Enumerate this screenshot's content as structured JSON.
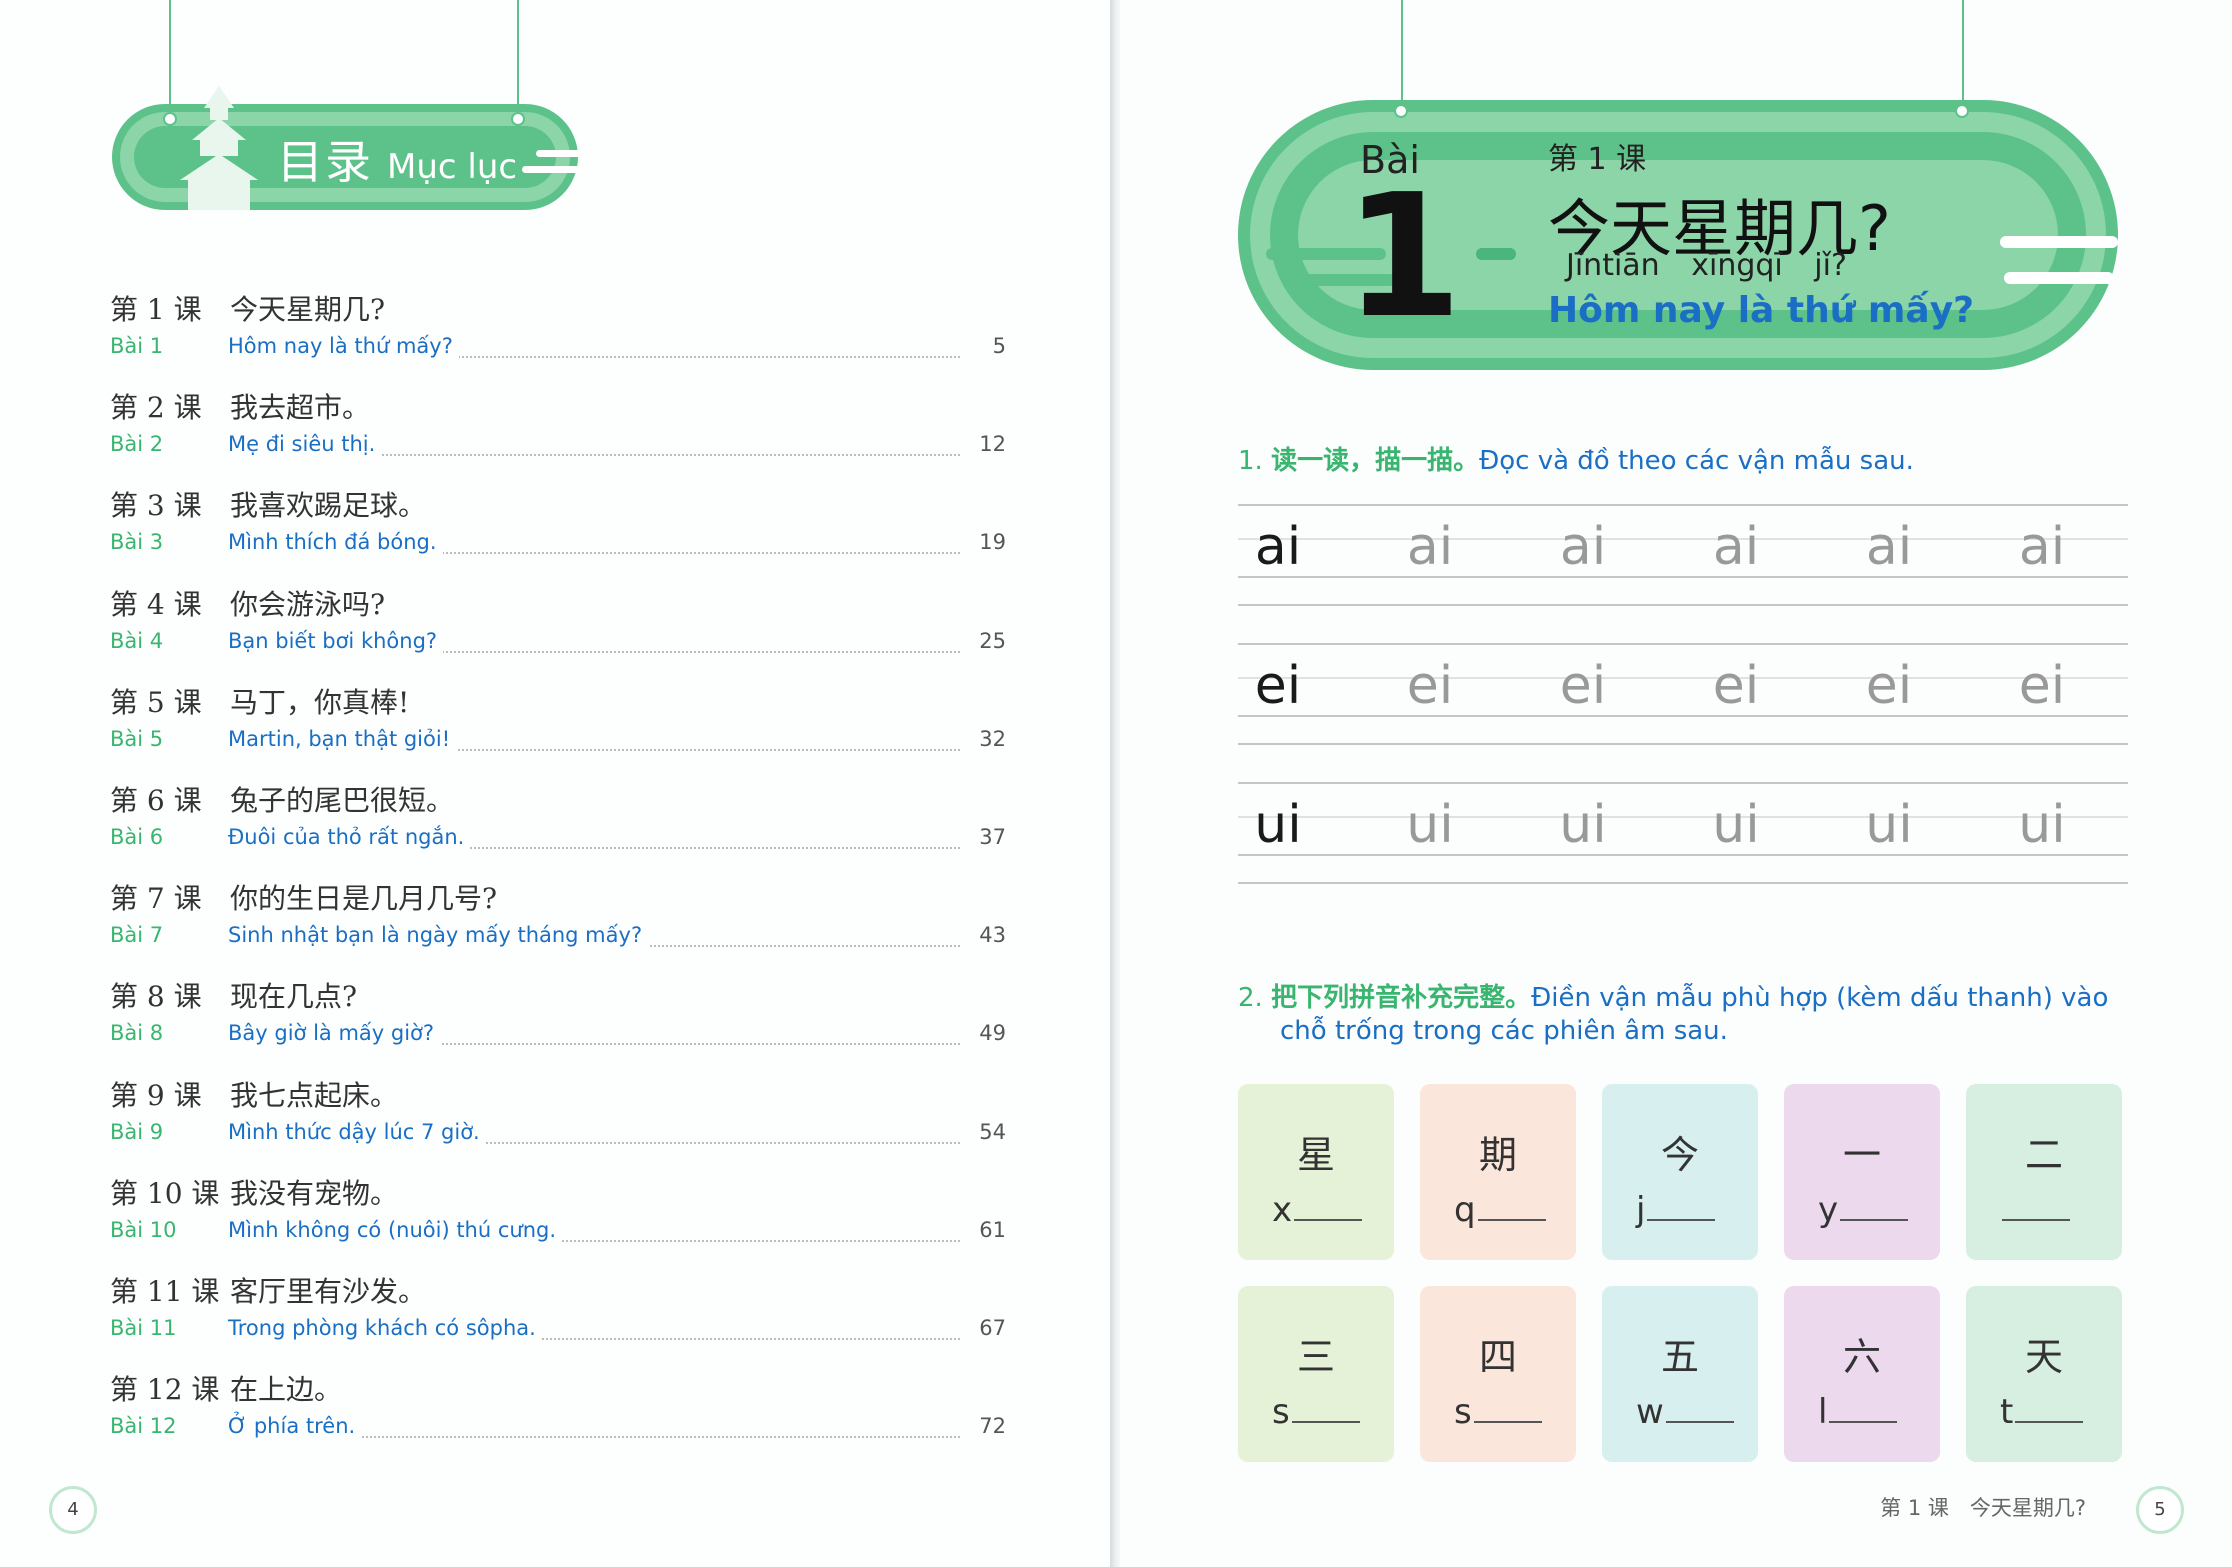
{
  "left_page": {
    "header": {
      "title_cn": "目录",
      "title_vn": "Mục lục"
    },
    "toc": [
      {
        "cn_num": "第 1 课",
        "cn_title": "今天星期几?",
        "vn_num": "Bài 1",
        "vn_title": "Hôm nay là thứ mấy?",
        "page": "5"
      },
      {
        "cn_num": "第 2 课",
        "cn_title": "我去超市。",
        "vn_num": "Bài 2",
        "vn_title": "Mẹ đi siêu thị.",
        "page": "12"
      },
      {
        "cn_num": "第 3 课",
        "cn_title": "我喜欢踢足球。",
        "vn_num": "Bài 3",
        "vn_title": "Mình thích đá bóng.",
        "page": "19"
      },
      {
        "cn_num": "第 4 课",
        "cn_title": "你会游泳吗?",
        "vn_num": "Bài 4",
        "vn_title": "Bạn biết bơi không?",
        "page": "25"
      },
      {
        "cn_num": "第 5 课",
        "cn_title": "马丁，你真棒!",
        "vn_num": "Bài 5",
        "vn_title": "Martin, bạn thật giỏi!",
        "page": "32"
      },
      {
        "cn_num": "第 6 课",
        "cn_title": "兔子的尾巴很短。",
        "vn_num": "Bài 6",
        "vn_title": "Đuôi của thỏ rất ngắn.",
        "page": "37"
      },
      {
        "cn_num": "第 7 课",
        "cn_title": "你的生日是几月几号?",
        "vn_num": "Bài 7",
        "vn_title": "Sinh nhật bạn là ngày mấy tháng mấy?",
        "page": "43"
      },
      {
        "cn_num": "第 8 课",
        "cn_title": "现在几点?",
        "vn_num": "Bài 8",
        "vn_title": "Bây giờ là mấy giờ?",
        "page": "49"
      },
      {
        "cn_num": "第 9 课",
        "cn_title": "我七点起床。",
        "vn_num": "Bài 9",
        "vn_title": "Mình thức dậy lúc 7 giờ.",
        "page": "54"
      },
      {
        "cn_num": "第 10 课",
        "cn_title": "我没有宠物。",
        "vn_num": "Bài 10",
        "vn_title": "Mình không có (nuôi) thú cưng.",
        "page": "61"
      },
      {
        "cn_num": "第 11 课",
        "cn_title": "客厅里有沙发。",
        "vn_num": "Bài 11",
        "vn_title": "Trong phòng khách có sôpha.",
        "page": "67"
      },
      {
        "cn_num": "第 12 课",
        "cn_title": "在上边。",
        "vn_num": "Bài 12",
        "vn_title": "Ở phía trên.",
        "page": "72"
      }
    ],
    "page_number": "4"
  },
  "right_page": {
    "lesson": {
      "bai_word": "Bài",
      "bai_number": "1",
      "cn_num": "第 1 课",
      "cn_title": "今天星期几?",
      "pinyin": "Jīntiān xīngqī jǐ?",
      "vn_title": "Hôm nay là thứ mấy?"
    },
    "exercise1": {
      "number": "1.",
      "title_cn": "读一读，描一描。",
      "title_vn": "Đọc và đồ theo các vận mẫu sau.",
      "rows": [
        [
          "ai",
          "ai",
          "ai",
          "ai",
          "ai",
          "ai"
        ],
        [
          "ei",
          "ei",
          "ei",
          "ei",
          "ei",
          "ei"
        ],
        [
          "ui",
          "ui",
          "ui",
          "ui",
          "ui",
          "ui"
        ]
      ]
    },
    "exercise2": {
      "number": "2.",
      "title_cn": "把下列拼音补充完整。",
      "title_vn_line1": "Điền vận mẫu phù hợp (kèm dấu thanh) vào",
      "title_vn_line2": "chỗ trống trong các phiên âm sau.",
      "cards": [
        {
          "char": "星",
          "initial": "x",
          "color": "#e6f2d7"
        },
        {
          "char": "期",
          "initial": "q",
          "color": "#fbe6db"
        },
        {
          "char": "今",
          "initial": "j",
          "color": "#d7f0ef"
        },
        {
          "char": "一",
          "initial": "y",
          "color": "#ecd9ee"
        },
        {
          "char": "二",
          "initial": "",
          "color": "#d6efe0"
        },
        {
          "char": "三",
          "initial": "s",
          "color": "#e6f2d7"
        },
        {
          "char": "四",
          "initial": "s",
          "color": "#fbe6db"
        },
        {
          "char": "五",
          "initial": "w",
          "color": "#d7f0ef"
        },
        {
          "char": "六",
          "initial": "l",
          "color": "#ecd9ee"
        },
        {
          "char": "天",
          "initial": "t",
          "color": "#d6efe0"
        }
      ]
    },
    "footer": {
      "text": "第 1 课　今天星期几?",
      "page_number": "5"
    }
  },
  "colors": {
    "green": "#5cc28a",
    "light_green": "#8bd5a8",
    "blue": "#1a6fc4",
    "label_green": "#3ab56f"
  }
}
